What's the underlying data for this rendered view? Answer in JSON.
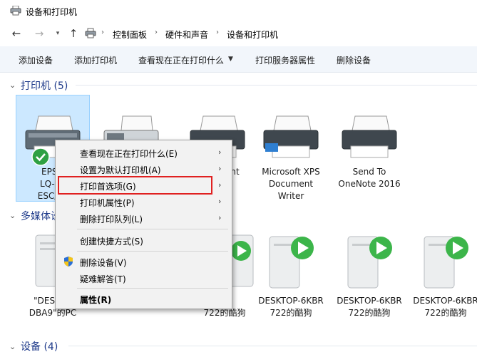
{
  "window": {
    "title": "设备和打印机"
  },
  "nav": {
    "back_icon": "back-arrow-icon",
    "forward_icon": "forward-arrow-icon",
    "recent_icon": "chevron-down-icon",
    "up_icon": "up-arrow-icon"
  },
  "address": {
    "breadcrumbs": [
      "控制面板",
      "硬件和声音",
      "设备和打印机"
    ]
  },
  "toolbar": {
    "items": [
      "添加设备",
      "添加打印机",
      "查看现在正在打印什么",
      "打印服务器属性",
      "删除设备"
    ]
  },
  "groups": {
    "printers": {
      "title": "打印机 (5)"
    },
    "multimedia": {
      "title": "多媒体设"
    },
    "devices": {
      "title": "设备 (4)"
    }
  },
  "printers": [
    {
      "label": "EPSO\nLQ-61\nESC/P2",
      "selected": true,
      "default_badge": "check-badge-icon"
    },
    {
      "label": "",
      "selected": false
    },
    {
      "label": "int",
      "selected": false
    },
    {
      "label": "Microsoft XPS\nDocument\nWriter",
      "selected": false
    },
    {
      "label": "Send To\nOneNote 2016",
      "selected": false
    }
  ],
  "media": [
    {
      "label": "\"DESKTO\nDBA9\"的PC"
    },
    {
      "label": "BR\n722的酷狗"
    },
    {
      "label": "DESKTOP-6KBR\n722的酷狗"
    },
    {
      "label": "DESKTOP-6KBR\n722的酷狗"
    },
    {
      "label": "DESKTOP-6KBR\n722的酷狗"
    }
  ],
  "context_menu": {
    "items": [
      {
        "label": "查看现在正在打印什么(E)",
        "submenu": true
      },
      {
        "label": "设置为默认打印机(A)",
        "submenu": true
      },
      {
        "label": "打印首选项(G)",
        "submenu": true,
        "highlighted": true
      },
      {
        "label": "打印机属性(P)",
        "submenu": true
      },
      {
        "label": "删除打印队列(L)",
        "submenu": true
      },
      {
        "label": "创建快捷方式(S)",
        "submenu": false
      },
      {
        "label": "删除设备(V)",
        "submenu": false,
        "icon": "uac-shield-icon"
      },
      {
        "label": "疑难解答(T)",
        "submenu": false
      },
      {
        "label": "属性(R)",
        "submenu": false,
        "bold": true
      }
    ]
  },
  "colors": {
    "highlight_box": "#e02020",
    "selection": "#cce8ff",
    "group_title": "#1e3a8a",
    "toolbar_bg": "#f2f6fb",
    "play_green": "#3cb54a"
  }
}
